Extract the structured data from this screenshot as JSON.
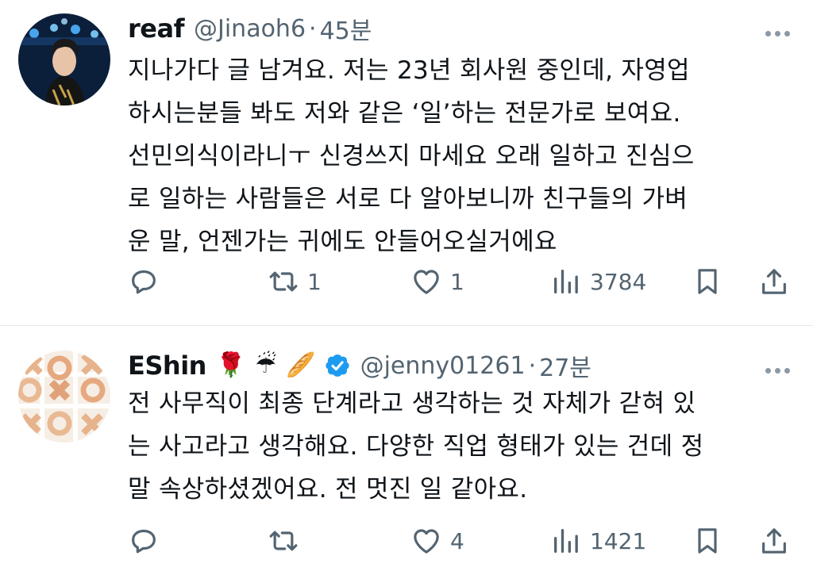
{
  "colors": {
    "text": "#0f1419",
    "secondary": "#536471",
    "divider": "#e1e8ed",
    "verified": "#1d9bf0"
  },
  "tweets": [
    {
      "display_name": "reaf",
      "handle": "@Jinaoh6",
      "separator": "·",
      "time": "45분",
      "text_lines": [
        "지나가다 글 남겨요. 저는 23년 회사원 중인데, 자영업",
        "하시는분들 봐도 저와 같은 ‘일’하는 전문가로 보여요.",
        "선민의식이라니ㅜ 신경쓰지 마세요 오래 일하고 진심으",
        "로 일하는 사람들은 서로 다 알아보니까 친구들의 가벼",
        "운 말, 언젠가는 귀에도 안들어오실거에요"
      ],
      "reply_icon": "reply-icon",
      "retweet_count": "1",
      "like_count": "1",
      "views_count": "3784"
    },
    {
      "display_name": "EShin",
      "emojis": [
        "🌹",
        "☔",
        "🥖"
      ],
      "verified_icon": "verified-badge-icon",
      "handle": "@jenny01261",
      "separator": "·",
      "time": "27분",
      "text_lines": [
        "전 사무직이 최종 단계라고 생각하는 것 자체가 갇혀 있",
        "는 사고라고 생각해요. 다양한 직업 형태가 있는 건데 정",
        "말 속상하셨겠어요. 전 멋진 일 같아요."
      ],
      "retweet_count": "",
      "like_count": "4",
      "views_count": "1421"
    }
  ]
}
